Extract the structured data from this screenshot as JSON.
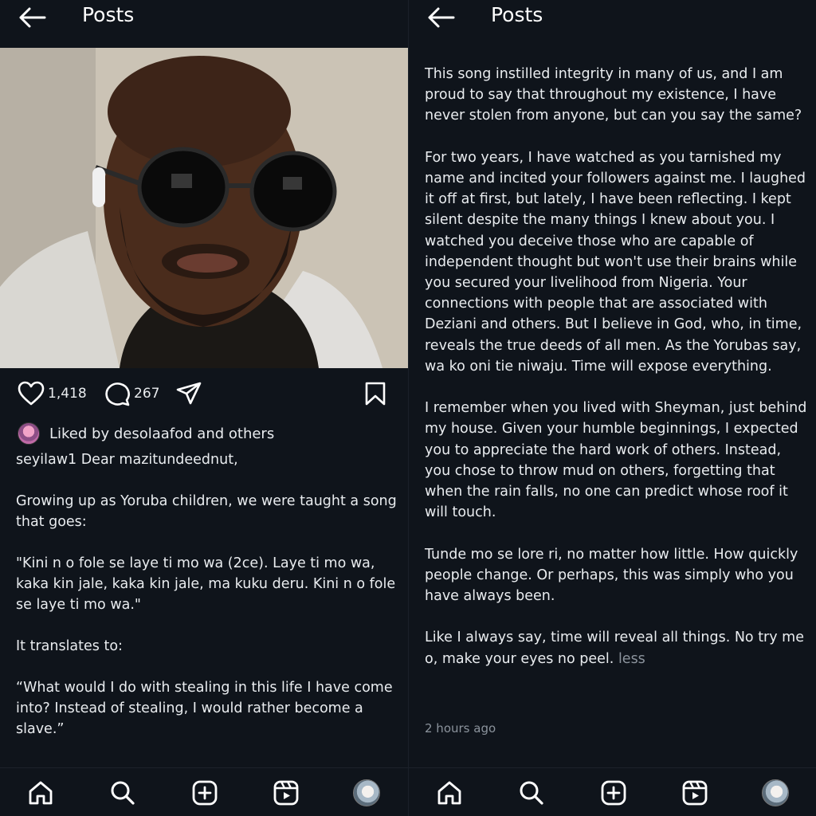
{
  "header": {
    "title": "Posts"
  },
  "post": {
    "likes": "1,418",
    "comments": "267",
    "liked_by": "Liked by desolaafod and others",
    "caption": [
      "seyilaw1 Dear mazitundeednut,",
      "Growing up as Yoruba children, we were taught a song that goes:",
      "\"Kini n o fole se laye ti mo wa (2ce). Laye ti mo wa, kaka kin jale, kaka kin jale, ma kuku deru. Kini n o fole se laye ti mo wa.\"",
      "It translates to:",
      "“What would I do with stealing in this life I have come into? Instead of stealing, I would rather become a slave.”"
    ],
    "continued": [
      "This song instilled integrity in many of us, and I am proud to say that throughout my existence, I have never stolen from anyone, but can you say the same?",
      "For two years, I have watched as you tarnished my name and incited your followers against me. I laughed it off at first, but lately, I have been reflecting. I kept silent despite the many things I knew about you. I watched you deceive those who are capable of independent thought but won't use their brains while you secured your livelihood from Nigeria. Your connections with people that are associated with Deziani and others. But I believe in God, who, in time, reveals the true deeds of all men. As the Yorubas say, wa ko oni tie niwaju. Time will expose everything.",
      "I remember when you lived with Sheyman, just behind my house. Given your humble beginnings, I expected you to appreciate the hard work of others. Instead, you chose to throw mud on others, forgetting that when the rain falls, no one can predict whose roof it will touch.",
      "Tunde mo se lore ri, no matter how little. How quickly people change. Or perhaps, this was simply who you have always been."
    ],
    "last_paragraph": "Like I always say, time will reveal all things. No try me o, make your eyes no peel.",
    "less_label": "less",
    "timestamp": "2 hours ago"
  },
  "icons": {
    "back": "arrow-left-icon",
    "like": "heart-icon",
    "comment": "comment-icon",
    "share": "paper-plane-icon",
    "save": "bookmark-icon",
    "nav": [
      "home-icon",
      "search-icon",
      "create-icon",
      "reels-icon",
      "profile-avatar"
    ]
  },
  "colors": {
    "background": "#0f141b",
    "text": "#e9ecef",
    "muted": "#8b939c"
  }
}
